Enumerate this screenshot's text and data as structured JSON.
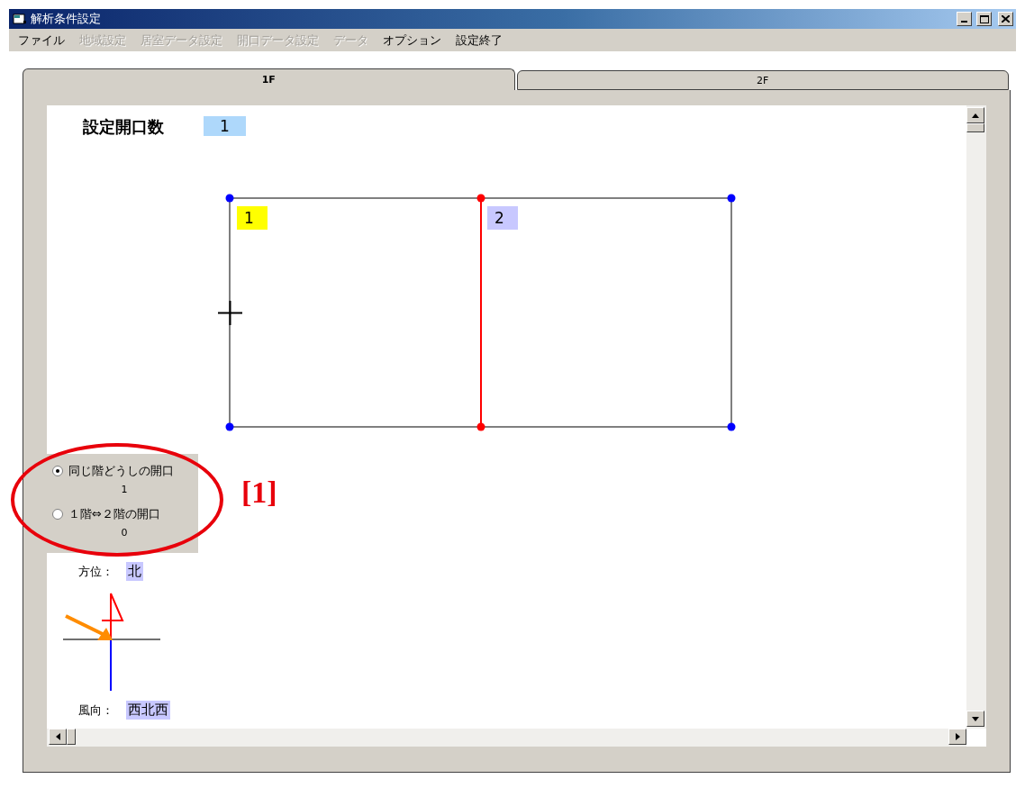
{
  "window": {
    "title": "解析条件設定"
  },
  "menu": [
    {
      "label": "ファイル",
      "disabled": false
    },
    {
      "label": "地域設定",
      "disabled": true
    },
    {
      "label": "居室データ設定",
      "disabled": true
    },
    {
      "label": "開口データ設定",
      "disabled": true
    },
    {
      "label": "データ",
      "disabled": true
    },
    {
      "label": "オプション",
      "disabled": false
    },
    {
      "label": "設定終了",
      "disabled": false
    }
  ],
  "tabs": [
    {
      "label": "1F",
      "selected": true
    },
    {
      "label": "2F",
      "selected": false
    }
  ],
  "opening_count": {
    "label": "設定開口数",
    "value": "1"
  },
  "plan": {
    "openings": [
      {
        "label": "1",
        "color": "#ffff00"
      },
      {
        "label": "2",
        "color": "#c8c8ff"
      }
    ]
  },
  "opening_type": [
    {
      "label": "同じ階どうしの開口",
      "count": "1",
      "selected": true
    },
    {
      "label": "１階⇔２階の開口",
      "count": "0",
      "selected": false
    }
  ],
  "orientation": {
    "label": "方位：",
    "value": "北"
  },
  "wind_direction": {
    "label": "風向：",
    "value": "西北西"
  },
  "annotation": {
    "label": "[1]"
  }
}
